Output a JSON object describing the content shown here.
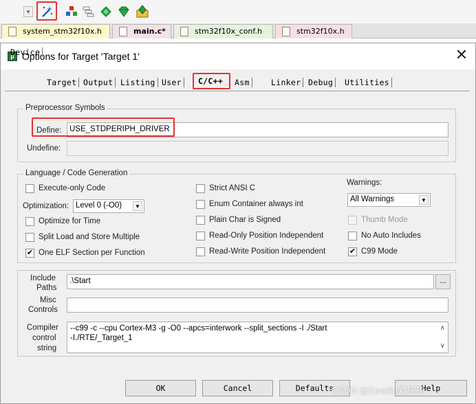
{
  "toolbar": {
    "icons": [
      "dropdown-arrow",
      "options-wand",
      "manage-components",
      "build-stack",
      "pack-installer",
      "select-pack",
      "manage-rte"
    ]
  },
  "file_tabs": [
    {
      "label": "system_stm32f10x.h",
      "icon": "header-file-icon"
    },
    {
      "label": "main.c*",
      "icon": "c-file-icon",
      "active": true
    },
    {
      "label": "stm32f10x_conf.h",
      "icon": "header-file-icon"
    },
    {
      "label": "stm32f10x.h",
      "icon": "header-file-icon"
    }
  ],
  "dialog": {
    "title": "Options for Target 'Target 1'",
    "close_glyph": "✕",
    "tabs": [
      "Device",
      "Target",
      "Output",
      "Listing",
      "User",
      "C/C++",
      "Asm",
      "Linker",
      "Debug",
      "Utilities"
    ],
    "active_tab": "C/C++"
  },
  "preprocessor": {
    "group_title": "Preprocessor Symbols",
    "define_label": "Define:",
    "define_value": "USE_STDPERIPH_DRIVER",
    "undefine_label": "Undefine:",
    "undefine_value": ""
  },
  "language": {
    "group_title": "Language / Code Generation",
    "execute_only": {
      "label": "Execute-only Code",
      "checked": false
    },
    "optimization_label": "Optimization:",
    "optimization_value": "Level 0 (-O0)",
    "optimize_time": {
      "label": "Optimize for Time",
      "checked": false
    },
    "split_load": {
      "label": "Split Load and Store Multiple",
      "checked": false
    },
    "one_elf": {
      "label": "One ELF Section per Function",
      "checked": true
    },
    "strict_ansi": {
      "label": "Strict ANSI C",
      "checked": false
    },
    "enum_container": {
      "label": "Enum Container always int",
      "checked": false
    },
    "plain_char": {
      "label": "Plain Char is Signed",
      "checked": false
    },
    "readonly_pi": {
      "label": "Read-Only Position Independent",
      "checked": false
    },
    "readwrite_pi": {
      "label": "Read-Write Position Independent",
      "checked": false
    },
    "warnings_label": "Warnings:",
    "warnings_value": "All Warnings",
    "thumb_mode": {
      "label": "Thumb Mode",
      "checked": false,
      "disabled": true
    },
    "no_auto_includes": {
      "label": "No Auto Includes",
      "checked": false
    },
    "c99_mode": {
      "label": "C99 Mode",
      "checked": true
    },
    "check_glyph": "✔"
  },
  "paths": {
    "include_label_1": "Include",
    "include_label_2": "Paths",
    "include_value": ".\\Start",
    "browse_label": "...",
    "misc_label_1": "Misc",
    "misc_label_2": "Controls",
    "misc_value": "",
    "compiler_label_1": "Compiler",
    "compiler_label_2": "control",
    "compiler_label_3": "string",
    "compiler_line_1": "--c99 -c --cpu Cortex-M3 -g -O0 --apcs=interwork --split_sections -I ./Start",
    "compiler_line_2": "-I./RTE/_Target_1"
  },
  "buttons": {
    "ok": "OK",
    "cancel": "Cancel",
    "defaults": "Defaults",
    "help": "Help"
  },
  "watermark": "CSDN @Zevalin爱灰灰",
  "colors": {
    "highlight_red": "#e8322f",
    "dialog_bg": "#f0f0f0"
  }
}
